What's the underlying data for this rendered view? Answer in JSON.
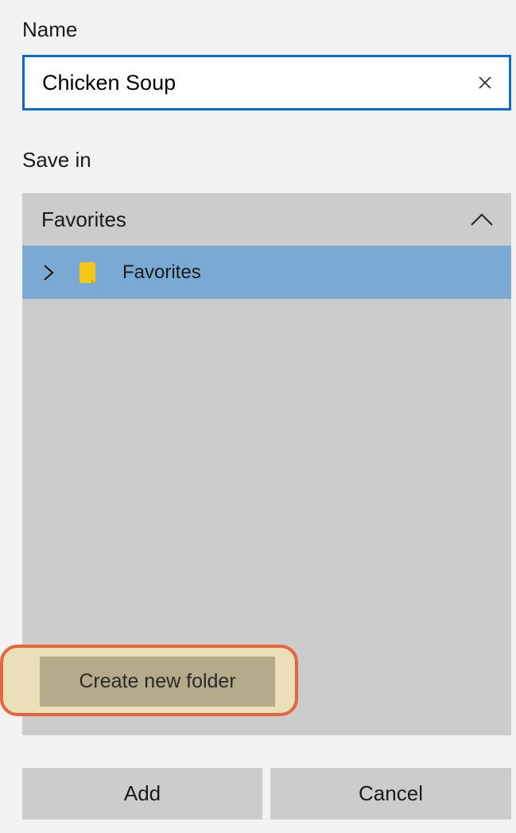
{
  "name_field": {
    "label": "Name",
    "value": "Chicken Soup",
    "clear_icon": "close-icon"
  },
  "save_in": {
    "label": "Save in",
    "panel_header": "Favorites",
    "header_icon": "chevron-up-icon",
    "tree_items": [
      {
        "label": "Favorites",
        "expand_icon": "chevron-right-icon",
        "folder_icon": "folder-icon",
        "selected": true
      }
    ],
    "create_folder_label": "Create new folder"
  },
  "buttons": {
    "add": "Add",
    "cancel": "Cancel"
  },
  "colors": {
    "accent": "#0a6cd2",
    "selected_row": "#7aaad3",
    "panel_bg": "#cccccc",
    "highlight_border": "#e8643c",
    "folder": "#f5c518"
  }
}
